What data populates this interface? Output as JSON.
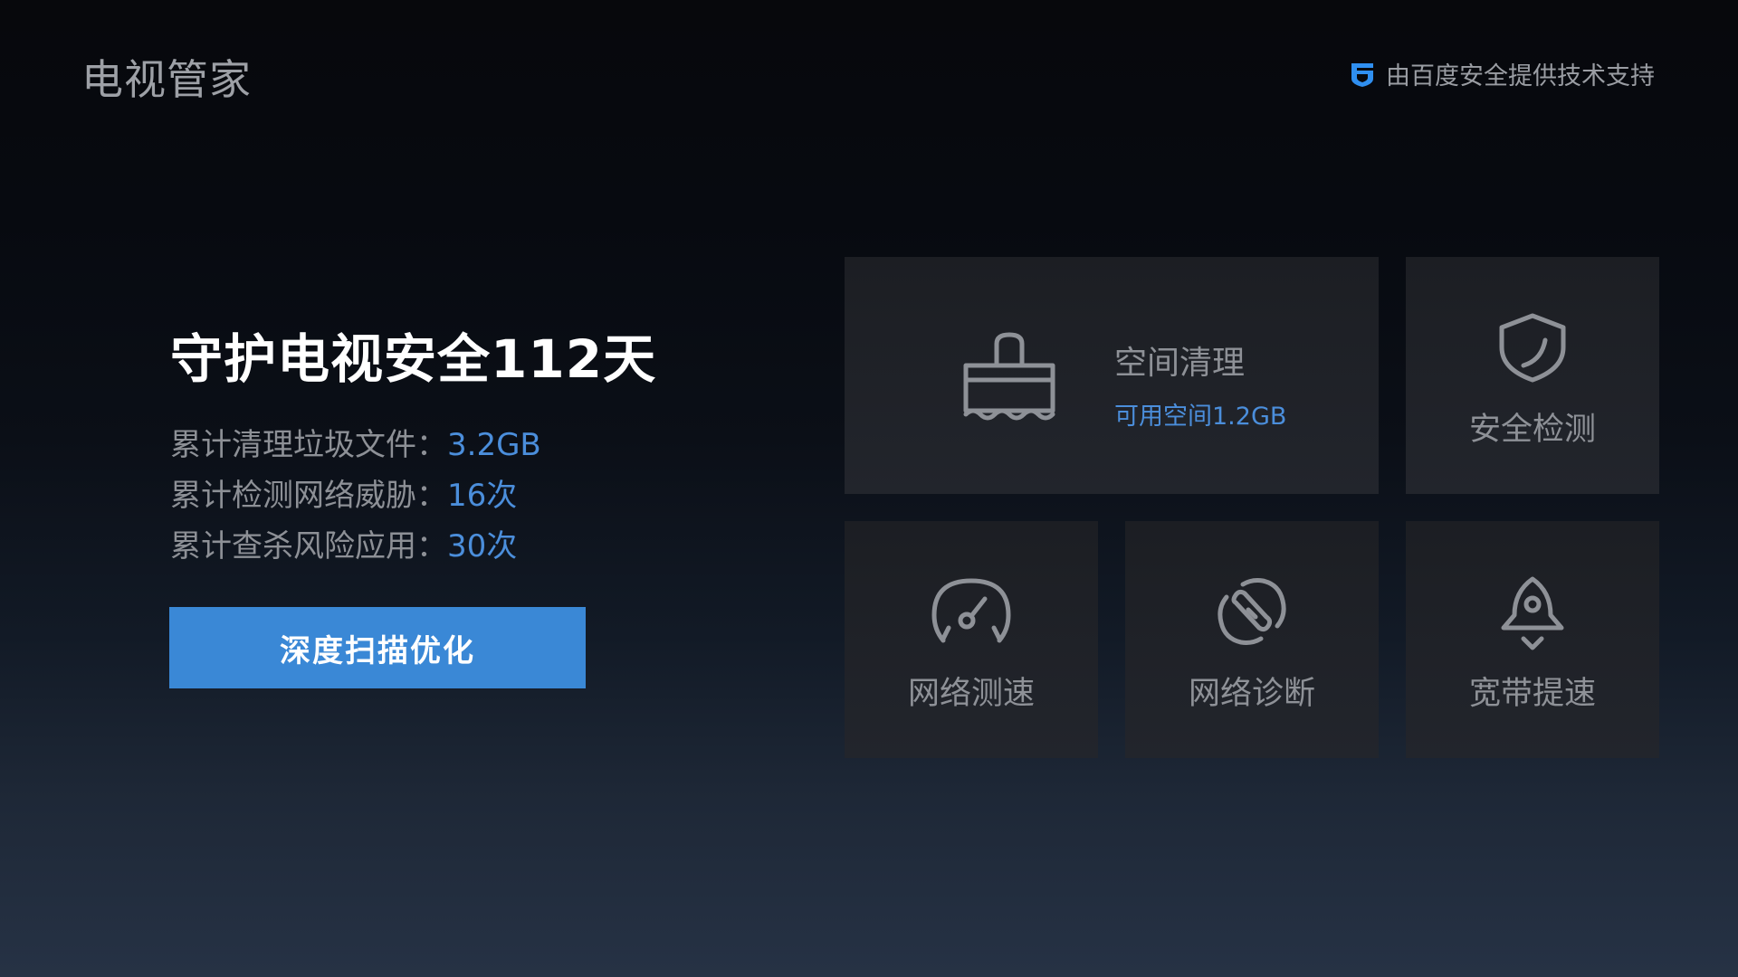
{
  "header": {
    "app_title": "电视管家",
    "provider_text": "由百度安全提供技术支持",
    "provider_icon": "baidu-security-shield-icon",
    "accent_color": "#3a88d6"
  },
  "hero": {
    "title": "守护电视安全112天",
    "stats": [
      {
        "label": "累计清理垃圾文件：",
        "value": "3.2GB"
      },
      {
        "label": "累计检测网络威胁：",
        "value": "16次"
      },
      {
        "label": "累计查杀风险应用：",
        "value": "30次"
      }
    ],
    "scan_button_label": "深度扫描优化"
  },
  "tiles": {
    "clean": {
      "title": "空间清理",
      "subtitle": "可用空间1.2GB",
      "icon": "brush-icon"
    },
    "security": {
      "label": "安全检测",
      "icon": "shield-icon"
    },
    "speed": {
      "label": "网络测速",
      "icon": "speedometer-icon"
    },
    "diagnose": {
      "label": "网络诊断",
      "icon": "link-broken-icon"
    },
    "boost": {
      "label": "宽带提速",
      "icon": "rocket-icon"
    }
  }
}
